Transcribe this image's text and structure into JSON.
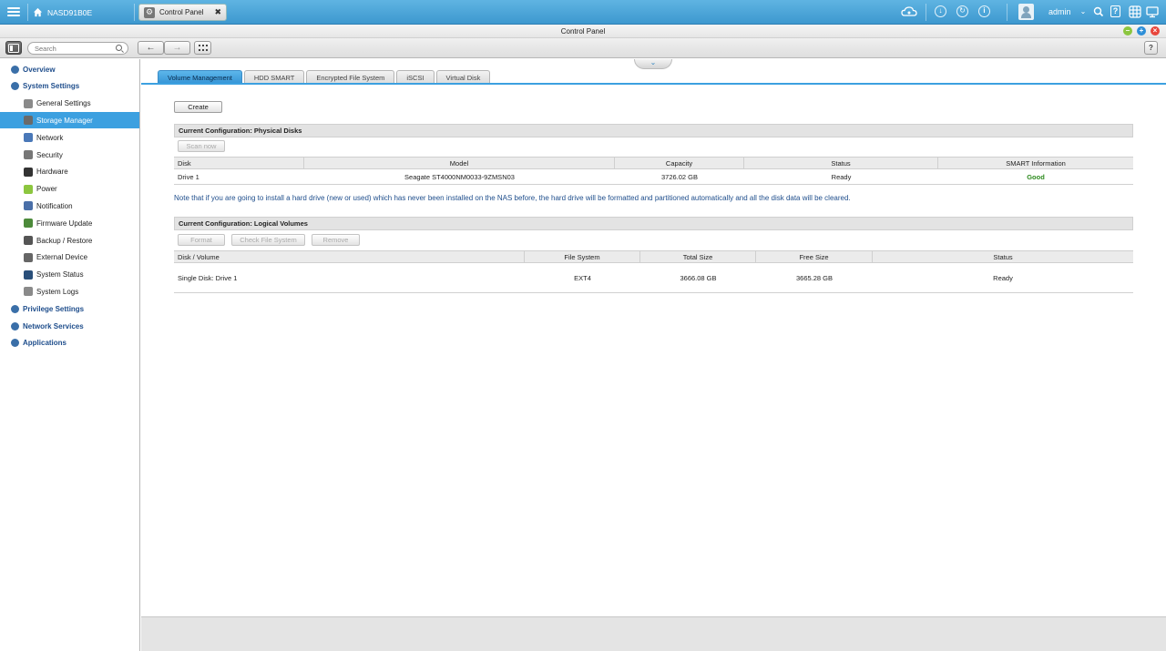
{
  "topbar": {
    "host_name": "NASD91B0E",
    "active_app_tab": "Control Panel",
    "user_name": "admin",
    "icons": [
      "menu-icon",
      "home-icon",
      "cloud-icon",
      "download-icon",
      "sync-icon",
      "info-icon",
      "user-icon",
      "search-icon",
      "help-icon",
      "grid-icon",
      "monitor-icon"
    ]
  },
  "window": {
    "title": "Control Panel",
    "controls": {
      "minimize": "–",
      "maximize": "+",
      "close": "×"
    }
  },
  "toolbar": {
    "search_placeholder": "Search",
    "back_glyph": "←",
    "forward_glyph": "→"
  },
  "sidebar": {
    "items": [
      {
        "label": "Overview",
        "level": "top",
        "icon": "overview-icon"
      },
      {
        "label": "System Settings",
        "level": "top",
        "icon": "gear-icon"
      },
      {
        "label": "General Settings",
        "level": "sub",
        "icon": "general-settings-icon"
      },
      {
        "label": "Storage Manager",
        "level": "sub",
        "icon": "storage-icon",
        "active": true
      },
      {
        "label": "Network",
        "level": "sub",
        "icon": "network-icon"
      },
      {
        "label": "Security",
        "level": "sub",
        "icon": "lock-icon"
      },
      {
        "label": "Hardware",
        "level": "sub",
        "icon": "hardware-icon"
      },
      {
        "label": "Power",
        "level": "sub",
        "icon": "power-icon"
      },
      {
        "label": "Notification",
        "level": "sub",
        "icon": "notification-icon"
      },
      {
        "label": "Firmware Update",
        "level": "sub",
        "icon": "firmware-icon"
      },
      {
        "label": "Backup / Restore",
        "level": "sub",
        "icon": "backup-icon"
      },
      {
        "label": "External Device",
        "level": "sub",
        "icon": "external-device-icon"
      },
      {
        "label": "System Status",
        "level": "sub",
        "icon": "system-status-icon"
      },
      {
        "label": "System Logs",
        "level": "sub",
        "icon": "logs-icon"
      },
      {
        "label": "Privilege Settings",
        "level": "top",
        "icon": "user-icon"
      },
      {
        "label": "Network Services",
        "level": "top",
        "icon": "network-services-icon"
      },
      {
        "label": "Applications",
        "level": "top",
        "icon": "applications-icon"
      }
    ]
  },
  "tabs": [
    {
      "label": "Volume Management",
      "active": true
    },
    {
      "label": "HDD SMART"
    },
    {
      "label": "Encrypted File System"
    },
    {
      "label": "iSCSI"
    },
    {
      "label": "Virtual Disk"
    }
  ],
  "volume_management": {
    "create_label": "Create",
    "physical": {
      "heading": "Current Configuration: Physical Disks",
      "scan_label": "Scan now",
      "columns": [
        "Disk",
        "Model",
        "Capacity",
        "Status",
        "SMART Information"
      ],
      "rows": [
        {
          "disk": "Drive 1",
          "model": "Seagate ST4000NM0033-9ZMSN03",
          "capacity": "3726.02 GB",
          "status": "Ready",
          "smart": "Good"
        }
      ],
      "smart_good_color": "#2e8b1f"
    },
    "note": "Note that if you are going to install a hard drive (new or used) which has never been installed on the NAS before, the hard drive will be formatted and partitioned automatically and all the disk data will be cleared.",
    "logical": {
      "heading": "Current Configuration: Logical Volumes",
      "buttons": [
        "Format",
        "Check File System",
        "Remove"
      ],
      "columns": [
        "Disk / Volume",
        "File System",
        "Total Size",
        "Free Size",
        "Status"
      ],
      "rows": [
        {
          "volume": "Single Disk: Drive 1",
          "fs": "EXT4",
          "total": "3666.08 GB",
          "free": "3665.28 GB",
          "status": "Ready"
        }
      ]
    }
  },
  "colors": {
    "accent": "#3ca0e0",
    "topbar": "#4aa6d9",
    "link_text": "#1f4e8c"
  }
}
